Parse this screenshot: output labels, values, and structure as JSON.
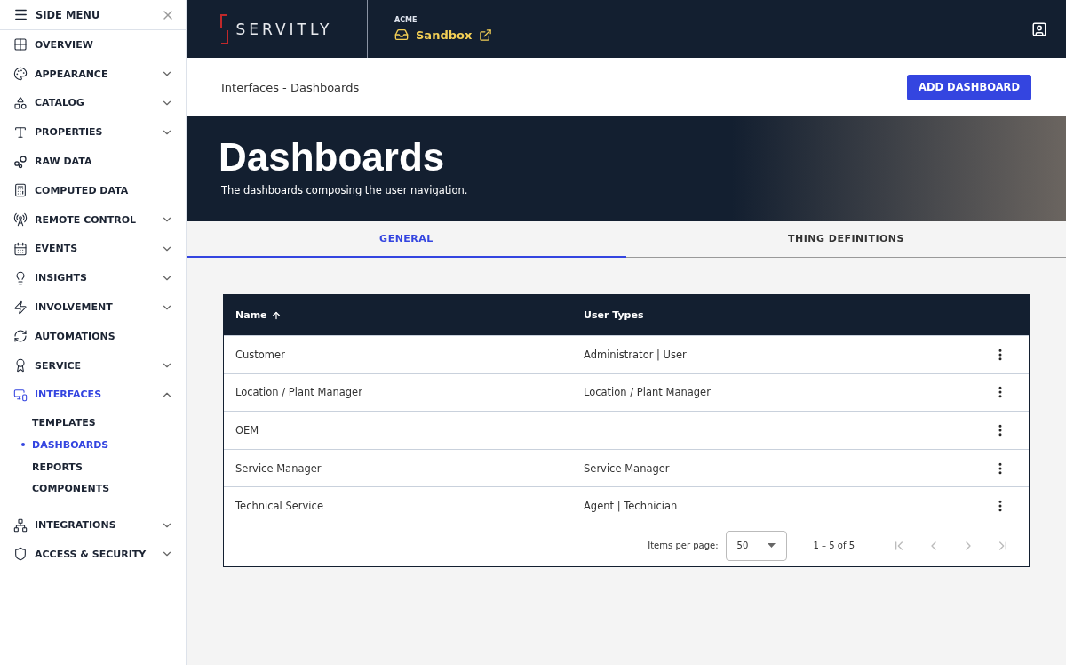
{
  "sidebar": {
    "title": "SIDE MENU",
    "items": [
      {
        "label": "OVERVIEW",
        "selected": false
      },
      {
        "label": "APPEARANCE",
        "selected": false,
        "expanded": false
      },
      {
        "label": "CATALOG",
        "selected": false,
        "expanded": false
      },
      {
        "label": "PROPERTIES",
        "selected": false,
        "expanded": false
      },
      {
        "label": "RAW DATA",
        "selected": false
      },
      {
        "label": "COMPUTED DATA",
        "selected": false
      },
      {
        "label": "REMOTE CONTROL",
        "selected": false,
        "expanded": false
      },
      {
        "label": "EVENTS",
        "selected": false,
        "expanded": false
      },
      {
        "label": "INSIGHTS",
        "selected": false,
        "expanded": false
      },
      {
        "label": "INVOLVEMENT",
        "selected": false,
        "expanded": false
      },
      {
        "label": "AUTOMATIONS",
        "selected": false
      },
      {
        "label": "SERVICE",
        "selected": false,
        "expanded": false
      },
      {
        "label": "INTERFACES",
        "selected": true,
        "expanded": true,
        "children": [
          {
            "label": "TEMPLATES",
            "selected": false
          },
          {
            "label": "DASHBOARDS",
            "selected": true
          },
          {
            "label": "REPORTS",
            "selected": false
          },
          {
            "label": "COMPONENTS",
            "selected": false
          }
        ]
      },
      {
        "label": "INTEGRATIONS",
        "selected": false,
        "expanded": false
      },
      {
        "label": "ACCESS & SECURITY",
        "selected": false,
        "expanded": false
      }
    ]
  },
  "header": {
    "logo": "SERVITLY",
    "tenant": "ACME",
    "environment": "Sandbox"
  },
  "breadcrumb": "Interfaces - Dashboards",
  "add_button": "ADD DASHBOARD",
  "hero": {
    "title": "Dashboards",
    "subtitle": "The dashboards composing the user navigation."
  },
  "tabs": [
    {
      "label": "GENERAL",
      "selected": true
    },
    {
      "label": "THING DEFINITIONS",
      "selected": false
    }
  ],
  "table": {
    "columns": [
      {
        "label": "Name",
        "sorted_ascending": true
      },
      {
        "label": "User Types"
      }
    ],
    "rows": [
      [
        "Customer",
        "Administrator | User"
      ],
      [
        "Location / Plant Manager",
        "Location / Plant Manager"
      ],
      [
        "OEM"
      ],
      [
        "Service Manager",
        "Service Manager"
      ],
      [
        "Technical Service",
        "Agent | Technician"
      ]
    ]
  },
  "pagination": {
    "label": "Items per page:",
    "page_size": "50",
    "range": "1 – 5 of 5",
    "nav_buttons": [
      {
        "disabled": true
      },
      {
        "disabled": true
      },
      {
        "disabled": true
      },
      {
        "disabled": true
      }
    ]
  }
}
